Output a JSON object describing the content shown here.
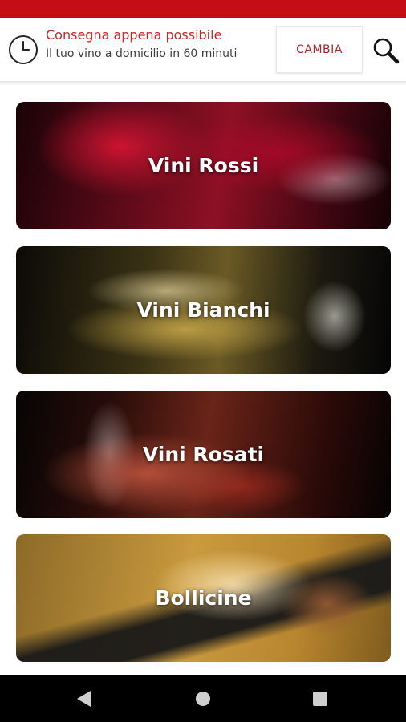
{
  "header": {
    "delivery_title": "Consegna appena possibile",
    "delivery_subtitle": "Il tuo vino a domicilio in 60 minuti",
    "change_button_label": "CAMBIA",
    "icons": {
      "left": "clock-icon",
      "right": "search-icon"
    }
  },
  "categories": [
    {
      "label": "Vini Rossi"
    },
    {
      "label": "Vini Bianchi"
    },
    {
      "label": "Vini Rosati"
    },
    {
      "label": "Bollicine"
    }
  ],
  "nav": {
    "icons": [
      "back-icon",
      "home-icon",
      "recents-icon"
    ]
  },
  "colors": {
    "status_bar": "#c40d17",
    "accent_text": "#c62828",
    "button_text": "#b3242a",
    "nav_bar": "#000000"
  }
}
